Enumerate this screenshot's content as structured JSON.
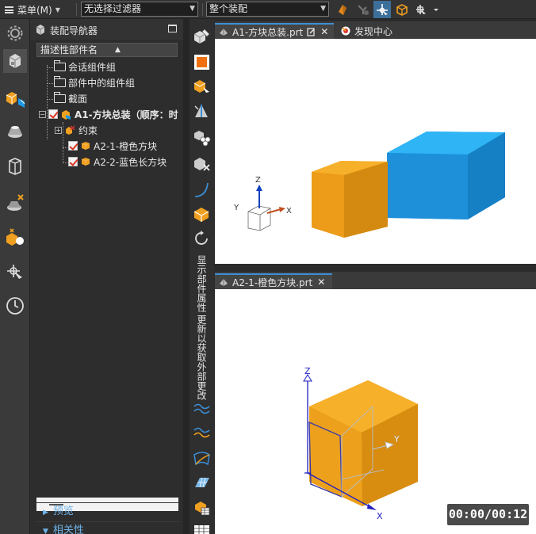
{
  "toolbar": {
    "menu_label": "菜单(M)",
    "filter_combo": "无选择过滤器",
    "scope_combo": "整个装配"
  },
  "navigator": {
    "title": "装配导航器",
    "column_header": "描述性部件名",
    "items": [
      {
        "label": "会话组件组"
      },
      {
        "label": "部件中的组件组"
      },
      {
        "label": "截面"
      },
      {
        "label": "A1-方块总装（顺序：时"
      },
      {
        "label": "约束"
      },
      {
        "label": "A2-1-橙色方块"
      },
      {
        "label": "A2-2-蓝色长方块"
      }
    ],
    "sections": [
      {
        "label": "预览"
      },
      {
        "label": "相关性"
      }
    ]
  },
  "vertical_tools": {
    "text1": "显示部件属性",
    "text2": "更新以获取外部更改"
  },
  "windows": [
    {
      "tabs": [
        {
          "label": "A1-方块总装.prt"
        },
        {
          "label": "发现中心"
        }
      ],
      "triad": {
        "x": "X",
        "y": "Y",
        "z": "Z"
      }
    },
    {
      "tabs": [
        {
          "label": "A2-1-橙色方块.prt"
        }
      ],
      "triad": {
        "x": "X",
        "y": "Y",
        "z": "Z"
      }
    }
  ],
  "video_timer": "00:00/00:12",
  "colors": {
    "orange": "#f0a020",
    "blue": "#1e9ae6",
    "accent": "#3d8fd6",
    "section_text": "#6fb3e8"
  }
}
